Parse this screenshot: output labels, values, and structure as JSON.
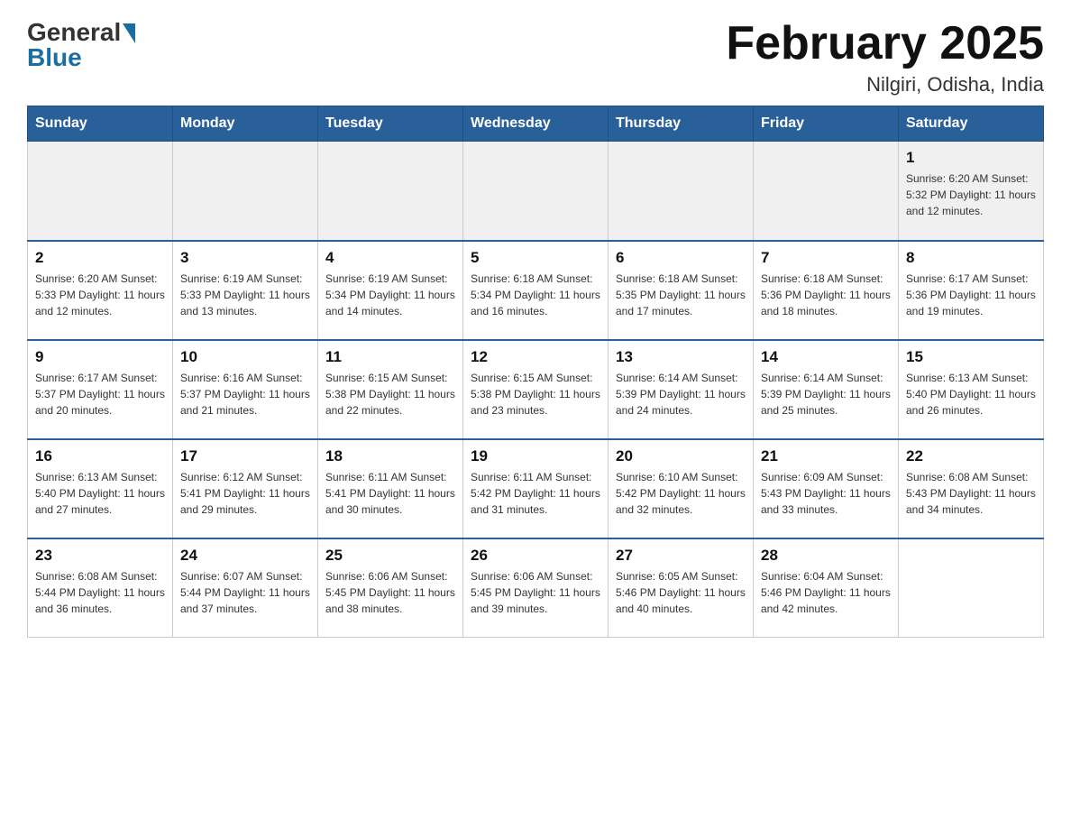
{
  "logo": {
    "general": "General",
    "blue": "Blue"
  },
  "header": {
    "title": "February 2025",
    "subtitle": "Nilgiri, Odisha, India"
  },
  "weekdays": [
    "Sunday",
    "Monday",
    "Tuesday",
    "Wednesday",
    "Thursday",
    "Friday",
    "Saturday"
  ],
  "weeks": [
    [
      {
        "day": "",
        "info": ""
      },
      {
        "day": "",
        "info": ""
      },
      {
        "day": "",
        "info": ""
      },
      {
        "day": "",
        "info": ""
      },
      {
        "day": "",
        "info": ""
      },
      {
        "day": "",
        "info": ""
      },
      {
        "day": "1",
        "info": "Sunrise: 6:20 AM\nSunset: 5:32 PM\nDaylight: 11 hours\nand 12 minutes."
      }
    ],
    [
      {
        "day": "2",
        "info": "Sunrise: 6:20 AM\nSunset: 5:33 PM\nDaylight: 11 hours\nand 12 minutes."
      },
      {
        "day": "3",
        "info": "Sunrise: 6:19 AM\nSunset: 5:33 PM\nDaylight: 11 hours\nand 13 minutes."
      },
      {
        "day": "4",
        "info": "Sunrise: 6:19 AM\nSunset: 5:34 PM\nDaylight: 11 hours\nand 14 minutes."
      },
      {
        "day": "5",
        "info": "Sunrise: 6:18 AM\nSunset: 5:34 PM\nDaylight: 11 hours\nand 16 minutes."
      },
      {
        "day": "6",
        "info": "Sunrise: 6:18 AM\nSunset: 5:35 PM\nDaylight: 11 hours\nand 17 minutes."
      },
      {
        "day": "7",
        "info": "Sunrise: 6:18 AM\nSunset: 5:36 PM\nDaylight: 11 hours\nand 18 minutes."
      },
      {
        "day": "8",
        "info": "Sunrise: 6:17 AM\nSunset: 5:36 PM\nDaylight: 11 hours\nand 19 minutes."
      }
    ],
    [
      {
        "day": "9",
        "info": "Sunrise: 6:17 AM\nSunset: 5:37 PM\nDaylight: 11 hours\nand 20 minutes."
      },
      {
        "day": "10",
        "info": "Sunrise: 6:16 AM\nSunset: 5:37 PM\nDaylight: 11 hours\nand 21 minutes."
      },
      {
        "day": "11",
        "info": "Sunrise: 6:15 AM\nSunset: 5:38 PM\nDaylight: 11 hours\nand 22 minutes."
      },
      {
        "day": "12",
        "info": "Sunrise: 6:15 AM\nSunset: 5:38 PM\nDaylight: 11 hours\nand 23 minutes."
      },
      {
        "day": "13",
        "info": "Sunrise: 6:14 AM\nSunset: 5:39 PM\nDaylight: 11 hours\nand 24 minutes."
      },
      {
        "day": "14",
        "info": "Sunrise: 6:14 AM\nSunset: 5:39 PM\nDaylight: 11 hours\nand 25 minutes."
      },
      {
        "day": "15",
        "info": "Sunrise: 6:13 AM\nSunset: 5:40 PM\nDaylight: 11 hours\nand 26 minutes."
      }
    ],
    [
      {
        "day": "16",
        "info": "Sunrise: 6:13 AM\nSunset: 5:40 PM\nDaylight: 11 hours\nand 27 minutes."
      },
      {
        "day": "17",
        "info": "Sunrise: 6:12 AM\nSunset: 5:41 PM\nDaylight: 11 hours\nand 29 minutes."
      },
      {
        "day": "18",
        "info": "Sunrise: 6:11 AM\nSunset: 5:41 PM\nDaylight: 11 hours\nand 30 minutes."
      },
      {
        "day": "19",
        "info": "Sunrise: 6:11 AM\nSunset: 5:42 PM\nDaylight: 11 hours\nand 31 minutes."
      },
      {
        "day": "20",
        "info": "Sunrise: 6:10 AM\nSunset: 5:42 PM\nDaylight: 11 hours\nand 32 minutes."
      },
      {
        "day": "21",
        "info": "Sunrise: 6:09 AM\nSunset: 5:43 PM\nDaylight: 11 hours\nand 33 minutes."
      },
      {
        "day": "22",
        "info": "Sunrise: 6:08 AM\nSunset: 5:43 PM\nDaylight: 11 hours\nand 34 minutes."
      }
    ],
    [
      {
        "day": "23",
        "info": "Sunrise: 6:08 AM\nSunset: 5:44 PM\nDaylight: 11 hours\nand 36 minutes."
      },
      {
        "day": "24",
        "info": "Sunrise: 6:07 AM\nSunset: 5:44 PM\nDaylight: 11 hours\nand 37 minutes."
      },
      {
        "day": "25",
        "info": "Sunrise: 6:06 AM\nSunset: 5:45 PM\nDaylight: 11 hours\nand 38 minutes."
      },
      {
        "day": "26",
        "info": "Sunrise: 6:06 AM\nSunset: 5:45 PM\nDaylight: 11 hours\nand 39 minutes."
      },
      {
        "day": "27",
        "info": "Sunrise: 6:05 AM\nSunset: 5:46 PM\nDaylight: 11 hours\nand 40 minutes."
      },
      {
        "day": "28",
        "info": "Sunrise: 6:04 AM\nSunset: 5:46 PM\nDaylight: 11 hours\nand 42 minutes."
      },
      {
        "day": "",
        "info": ""
      }
    ]
  ]
}
